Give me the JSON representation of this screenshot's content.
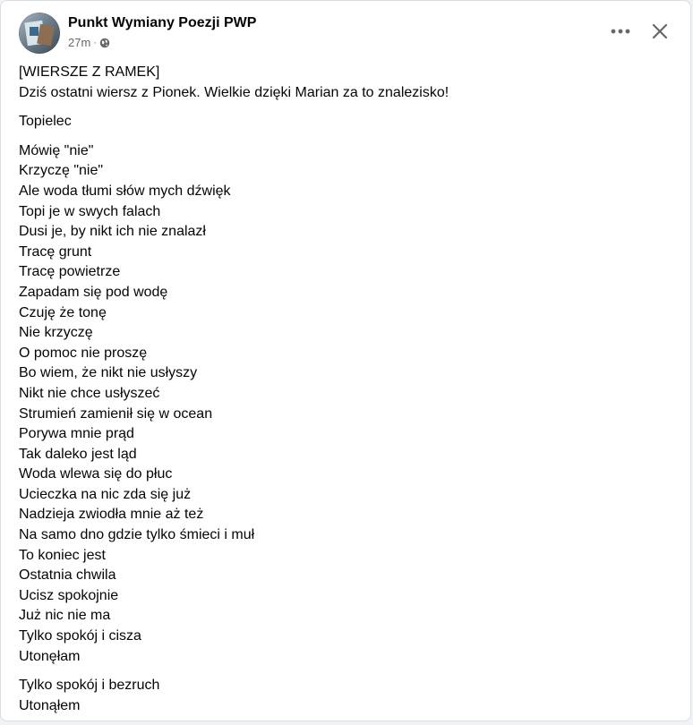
{
  "post": {
    "author": "Punkt Wymiany Poezji PWP",
    "time": "27m",
    "separator": "·",
    "audience_icon": "globe-icon",
    "more_icon": "more-options-icon",
    "close_icon": "close-icon",
    "intro_lines": [
      "[WIERSZE Z RAMEK]",
      "Dziś ostatni wiersz z Pionek. Wielkie dzięki Marian za to znalezisko!"
    ],
    "poem_title": "Topielec",
    "stanza_1": [
      "Mówię \"nie\"",
      "Krzyczę \"nie\"",
      "Ale woda tłumi słów mych dźwięk",
      "Topi je w swych falach",
      "Dusi je, by nikt ich nie znalazł",
      "Tracę grunt",
      "Tracę powietrze",
      "Zapadam się pod wodę",
      "Czuję że tonę",
      "Nie krzyczę",
      "O pomoc nie proszę",
      "Bo wiem, że nikt nie usłyszy",
      "Nikt nie chce usłyszeć",
      "Strumień zamienił się w ocean",
      "Porywa mnie prąd",
      "Tak daleko jest ląd",
      "Woda wlewa się do płuc",
      "Ucieczka na nic zda się już",
      "Nadzieja zwiodła mnie aż też",
      "Na samo dno gdzie tylko śmieci i muł",
      "To koniec jest",
      "Ostatnia chwila",
      "Ucisz spokojnie",
      "Już nic nie ma",
      "Tylko spokój i cisza",
      "Utonęłam"
    ],
    "stanza_2": [
      "Tylko spokój i bezruch",
      "Utonąłem"
    ]
  }
}
